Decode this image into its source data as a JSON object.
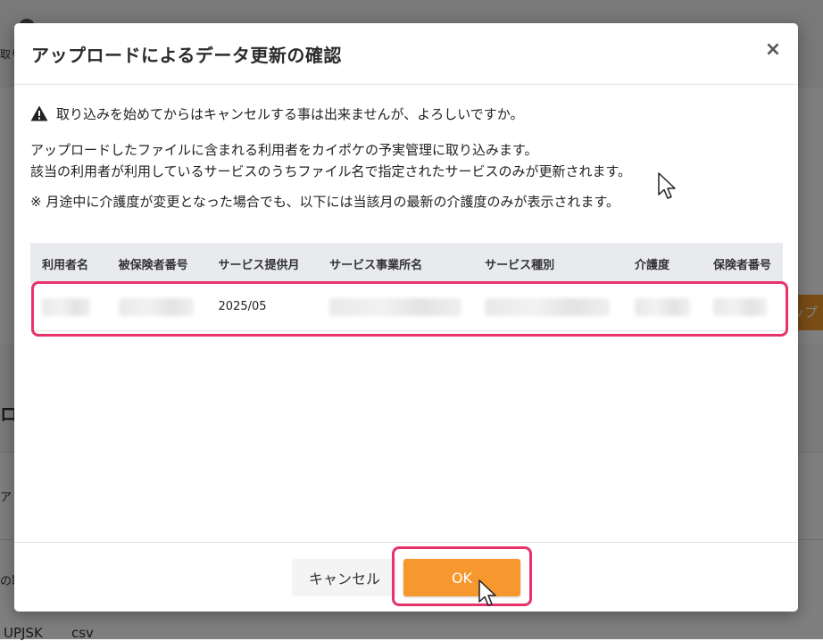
{
  "background": {
    "fragment_left_top": "取り",
    "fragment_right_orange": "ップ",
    "fragment_left_mid": "ロー",
    "fragment_left_mid2": "ア",
    "fragment_left_low": "の取",
    "fragment_bottom_1": "UPJSK",
    "fragment_bottom_2": "csv"
  },
  "modal": {
    "title": "アップロードによるデータ更新の確認",
    "close_label": "×",
    "warning": "取り込みを始めてからはキャンセルする事は出来ませんが、よろしいですか。",
    "paragraph1_line1": "アップロードしたファイルに含まれる利用者をカイポケの予実管理に取り込みます。",
    "paragraph1_line2": "該当の利用者が利用しているサービスのうちファイル名で指定されたサービスのみが更新されます。",
    "paragraph2": "※ 月途中に介護度が変更となった場合でも、以下には当該月の最新の介護度のみが表示されます。",
    "table": {
      "headers": [
        "利用者名",
        "被保険者番号",
        "サービス提供月",
        "サービス事業所名",
        "サービス種別",
        "介護度",
        "保険者番号"
      ],
      "rows": [
        {
          "service_month": "2025/05"
        }
      ]
    },
    "buttons": {
      "cancel": "キャンセル",
      "ok": "OK"
    }
  },
  "colors": {
    "accent_orange": "#f7982f",
    "highlight_pink": "#e8336a",
    "table_header_bg": "#e8eaee"
  }
}
